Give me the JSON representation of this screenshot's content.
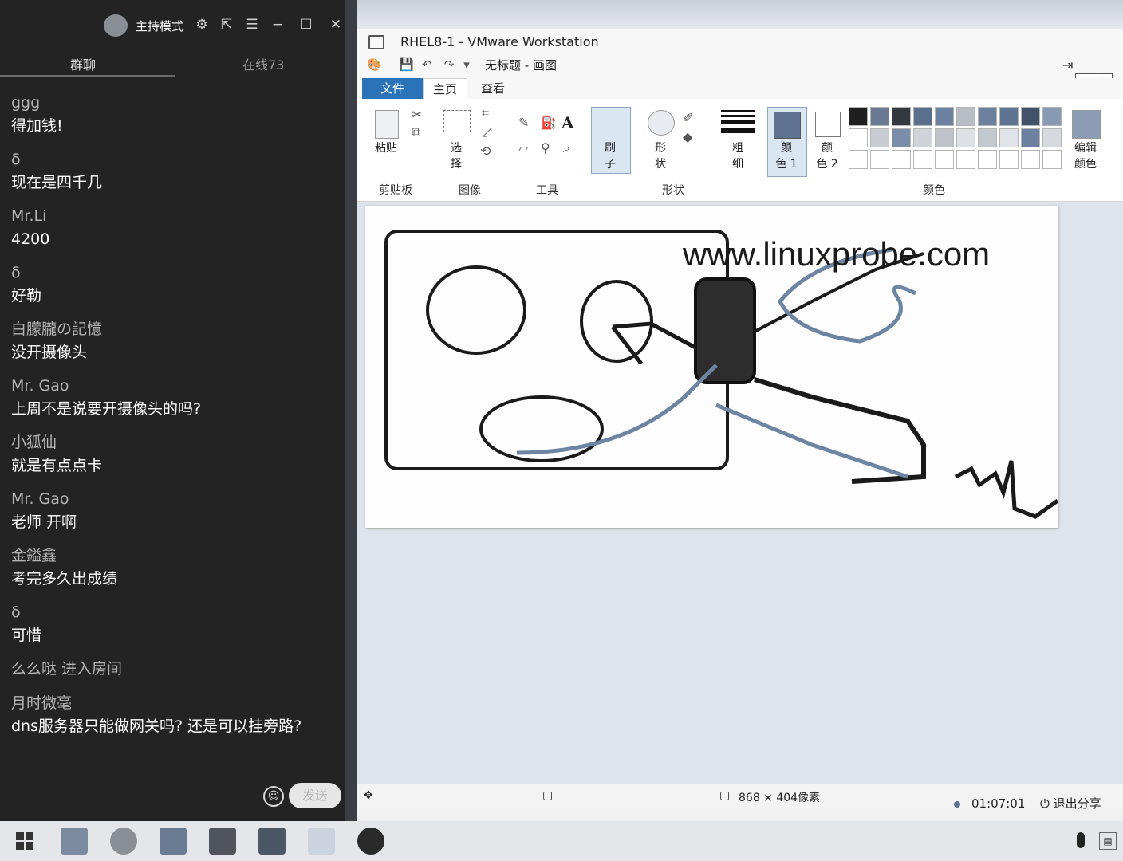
{
  "chat": {
    "title": "主持模式",
    "tabs": {
      "group": "群聊",
      "online": "在线73"
    },
    "messages": [
      {
        "name": "ggg",
        "text": "得加钱!"
      },
      {
        "name": "δ",
        "text": "现在是四千几"
      },
      {
        "name": "Mr.Li",
        "text": "4200"
      },
      {
        "name": "δ",
        "text": "好勒"
      },
      {
        "name": "白朦朧の記憶",
        "text": "没开摄像头"
      },
      {
        "name": "Mr. Gao",
        "text": "上周不是说要开摄像头的吗?"
      },
      {
        "name": "小狐仙",
        "text": "就是有点点卡"
      },
      {
        "name": "Mr. Gao",
        "text": "老师 开啊"
      },
      {
        "name": "金鎰鑫",
        "text": "考完多久出成绩"
      },
      {
        "name": "δ",
        "text": "可惜"
      }
    ],
    "system_message": "么么哒 进入房间",
    "last_message": {
      "name": "月时微毫",
      "text": "dns服务器只能做网关吗? 还是可以挂旁路?"
    },
    "send_label": "发送"
  },
  "vmware": {
    "title": "RHEL8-1 - VMware Workstation"
  },
  "paint": {
    "title": "无标题 - 画图",
    "minimize_tooltip": "最小化",
    "tabs": {
      "file": "文件",
      "home": "主页",
      "view": "查看"
    },
    "buttons": {
      "paste": "粘贴",
      "select_1": "选",
      "select_2": "择",
      "brush_1": "刷",
      "brush_2": "子",
      "shape_1": "形",
      "shape_2": "状",
      "size_1": "粗",
      "size_2": "细",
      "color1_1": "颜",
      "color1_2": "色 1",
      "color2_1": "颜",
      "color2_2": "色 2",
      "edit_colors_1": "编辑",
      "edit_colors_2": "颜色"
    },
    "groups": {
      "clipboard": "剪贴板",
      "image": "图像",
      "tools": "工具",
      "shapes": "形状",
      "colors": "颜色"
    },
    "canvas_text": "www.linuxprobe.com",
    "canvas_size": "868 × 404像素",
    "primary_color": "#5f7491",
    "palette_row1": [
      "#1f1f1f",
      "#6a7a92",
      "#34393f",
      "#5a6f8c",
      "#6d82a0",
      "#b9bec6",
      "#6c819e",
      "#5f7491",
      "#415269",
      "#8899b3"
    ],
    "palette_row2": [
      "#ffffff",
      "#c9cdd3",
      "#7a8ea9",
      "#d0d3d8",
      "#bfc4cb",
      "#dde0e4",
      "#c3c8cf",
      "#e0e3e7",
      "#6d82a0",
      "#d6d9dd"
    ]
  },
  "share": {
    "timer": "01:07:01",
    "exit": "退出分享"
  }
}
